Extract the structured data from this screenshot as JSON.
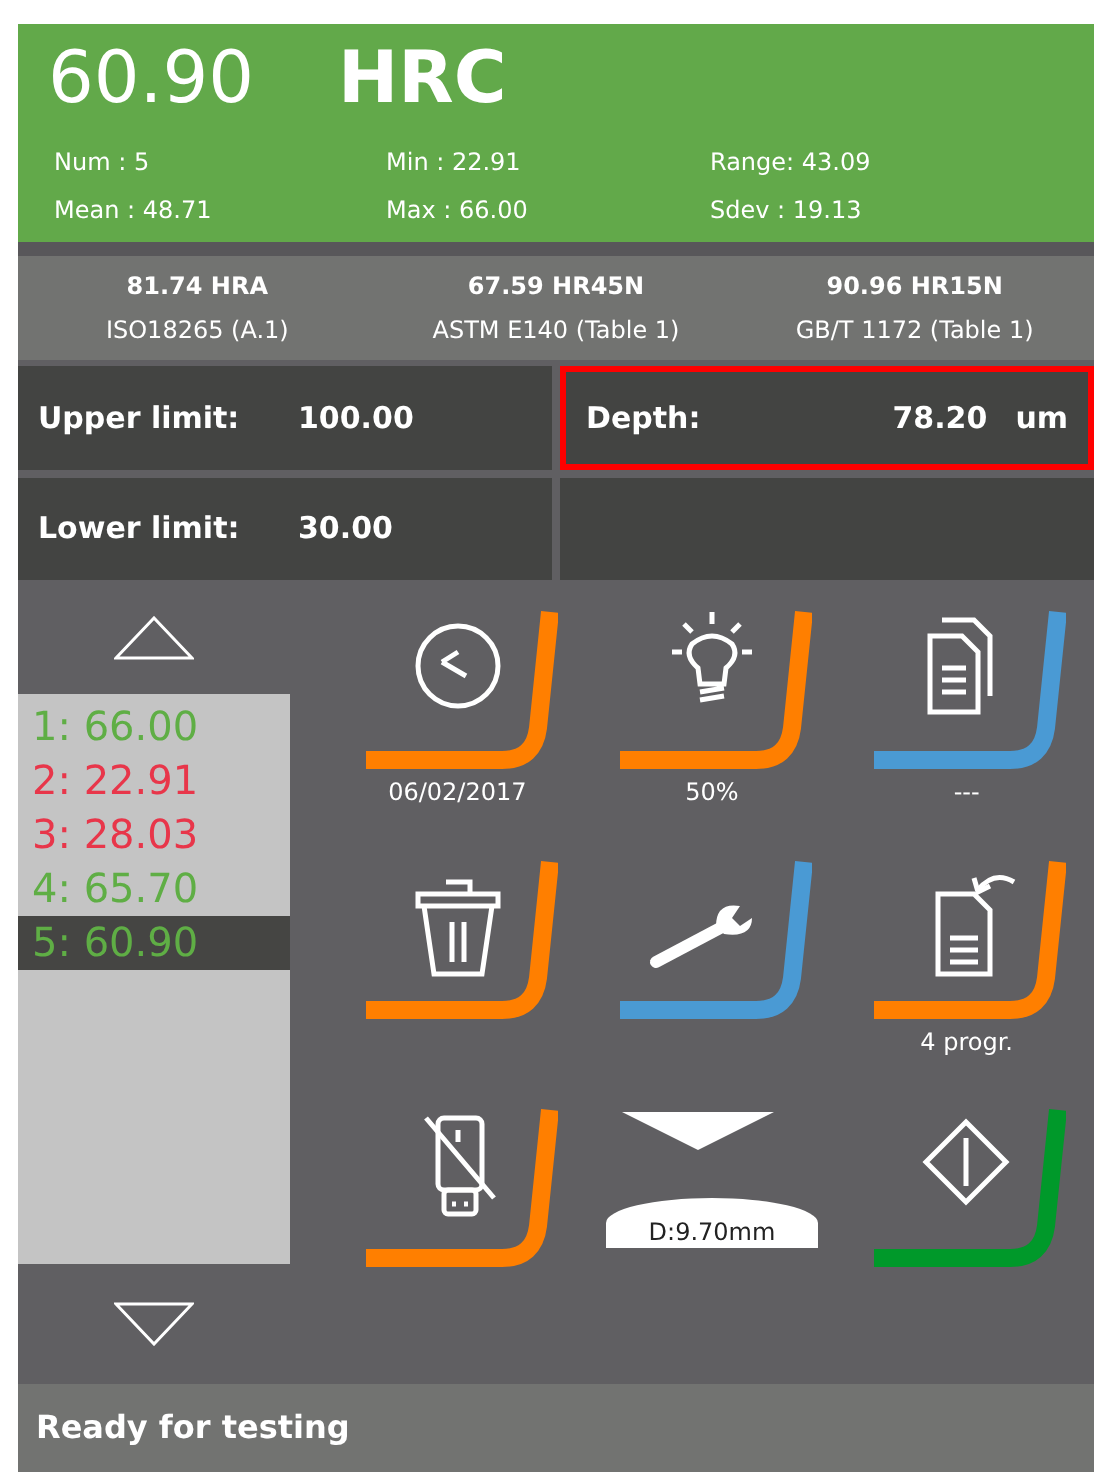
{
  "header": {
    "value": "60.90",
    "unit": "HRC",
    "stats": [
      "Num : 5",
      "Min : 22.91",
      "Range: 43.09",
      "Mean : 48.71",
      "Max : 66.00",
      "Sdev : 19.13"
    ]
  },
  "conversions": [
    {
      "value": "81.74 HRA",
      "standard": "ISO18265 (A.1)"
    },
    {
      "value": "67.59 HR45N",
      "standard": "ASTM E140 (Table 1)"
    },
    {
      "value": "90.96 HR15N",
      "standard": "GB/T 1172 (Table 1)"
    }
  ],
  "fields": [
    {
      "label": "Upper limit:",
      "value": "100.00",
      "highlighted": false
    },
    {
      "label": "Depth:",
      "value": "78.20",
      "unit": "um",
      "highlighted": true
    },
    {
      "label": "Lower limit:",
      "value": "30.00",
      "highlighted": false
    }
  ],
  "results": [
    {
      "text": "1: 66.00",
      "in_limits": true,
      "selected": false
    },
    {
      "text": "2: 22.91",
      "in_limits": false,
      "selected": false
    },
    {
      "text": "3: 28.03",
      "in_limits": false,
      "selected": false
    },
    {
      "text": "4: 65.70",
      "in_limits": true,
      "selected": false
    },
    {
      "text": "5: 60.90",
      "in_limits": true,
      "selected": true
    }
  ],
  "tiles": [
    {
      "kind": "clock",
      "color": "#ff7f00",
      "caption": "06/02/2017"
    },
    {
      "kind": "lamp",
      "color": "#ff7f00",
      "caption": "50%"
    },
    {
      "kind": "copy",
      "color": "#4a9ad4",
      "caption": "---"
    },
    {
      "kind": "trash",
      "color": "#ff7f00"
    },
    {
      "kind": "wrench",
      "color": "#4a9ad4"
    },
    {
      "kind": "program",
      "color": "#ff7f00",
      "caption": "4 progr."
    },
    {
      "kind": "usb",
      "color": "#ff7f00"
    },
    {
      "kind": "indenter",
      "caption": "D:9.70mm"
    },
    {
      "kind": "start",
      "color": "#00992a"
    }
  ],
  "status_bar": {
    "text": "Ready for testing"
  }
}
